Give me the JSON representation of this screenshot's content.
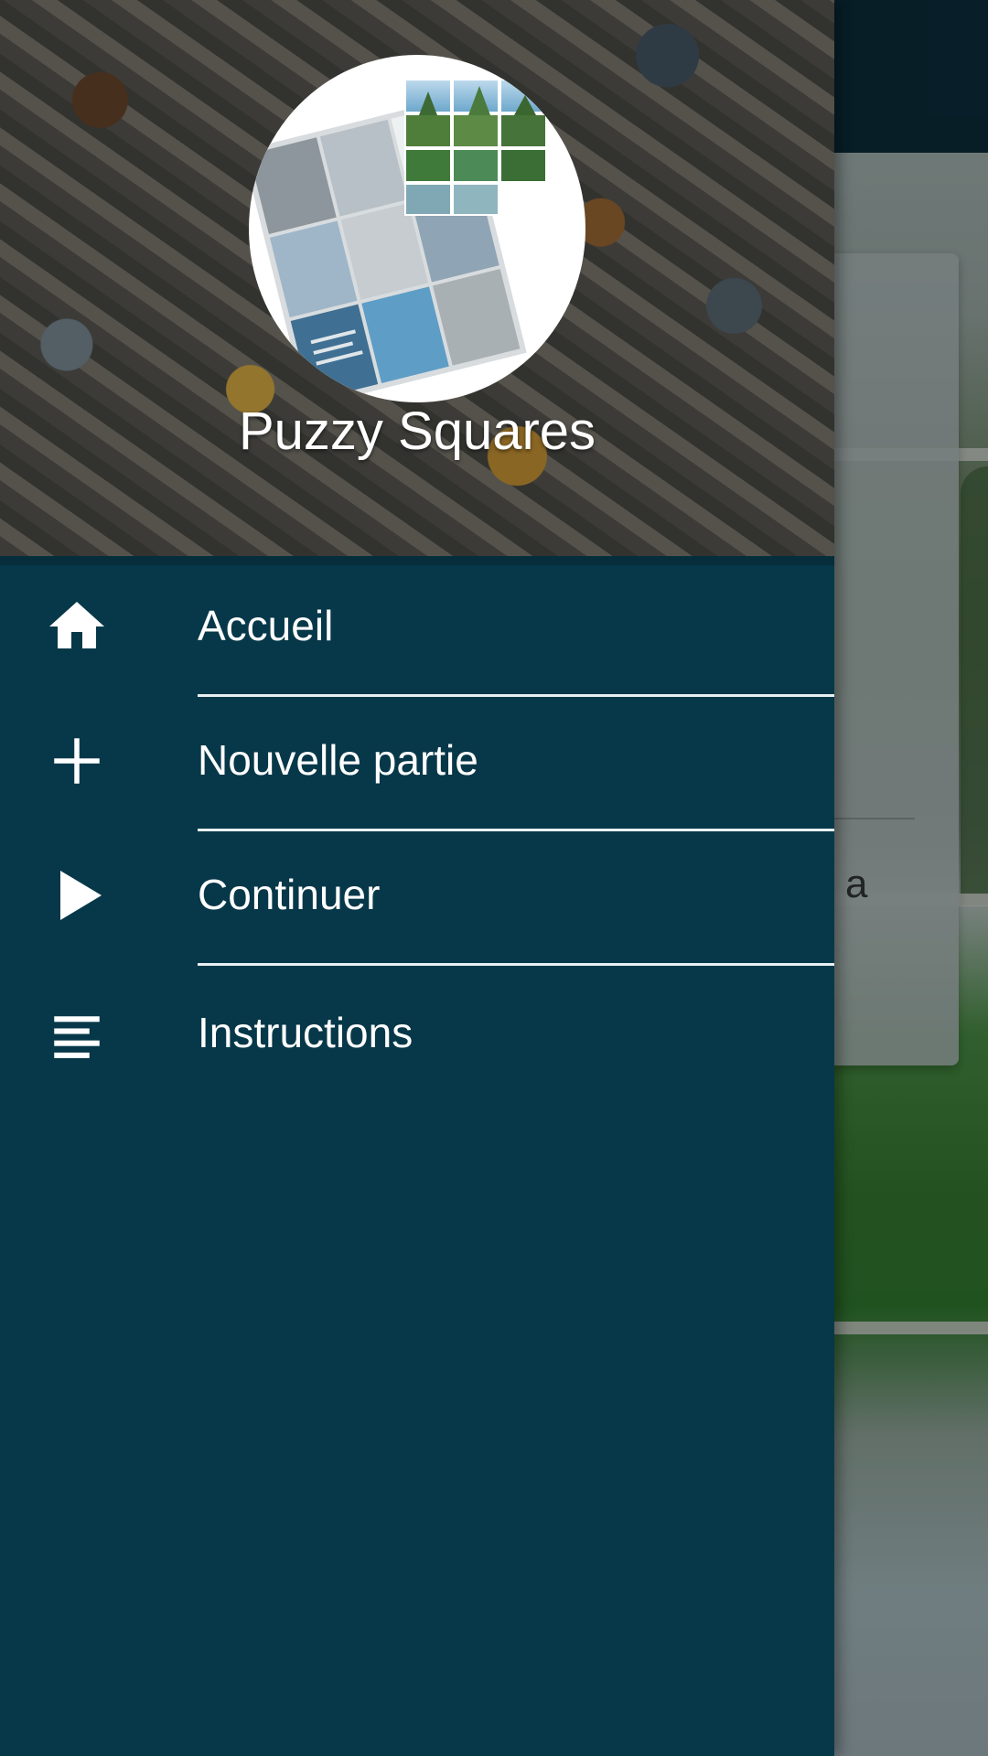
{
  "drawer": {
    "app_title": "Puzzy Squares",
    "header_background": "jigsaw-puzzle-pieces-photo",
    "logo": "puzzy-squares-logo",
    "background_color": "#073849",
    "menu_items": [
      {
        "label": "Accueil",
        "icon": "home-icon"
      },
      {
        "label": "Nouvelle partie",
        "icon": "plus-icon"
      },
      {
        "label": "Continuer",
        "icon": "play-icon"
      },
      {
        "label": "Instructions",
        "icon": "instructions-icon"
      }
    ]
  },
  "background_screen": {
    "card_text_fragment": "l a",
    "toolbar_color": "#0a2733"
  }
}
